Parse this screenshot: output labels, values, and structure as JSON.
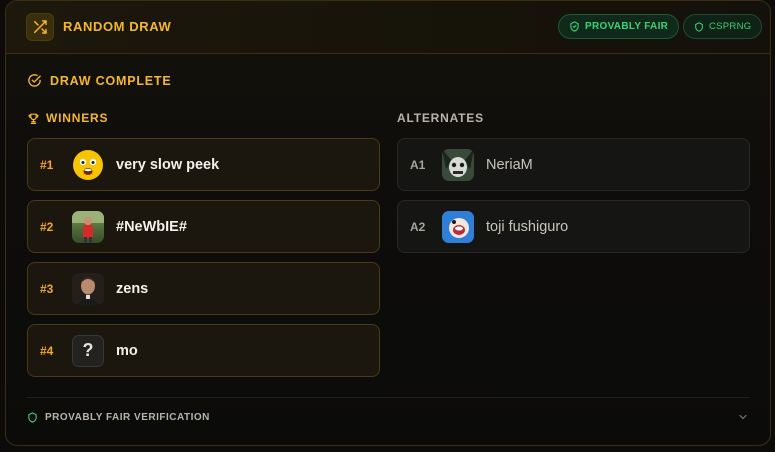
{
  "header": {
    "title": "RANDOM DRAW",
    "badge_fair": "PROVABLY FAIR",
    "badge_csprng": "CSPRNG"
  },
  "status": {
    "label": "DRAW COMPLETE"
  },
  "winners": {
    "heading": "WINNERS",
    "items": [
      {
        "rank": "#1",
        "name": "very slow peek",
        "avatar": "yellow-face-avatar"
      },
      {
        "rank": "#2",
        "name": "#NeWbIE#",
        "avatar": "red-figure-avatar"
      },
      {
        "rank": "#3",
        "name": "zens",
        "avatar": "portrait-avatar"
      },
      {
        "rank": "#4",
        "name": "mo",
        "avatar": "unknown-avatar"
      }
    ]
  },
  "alternates": {
    "heading": "ALTERNATES",
    "items": [
      {
        "rank": "A1",
        "name": "NeriaM",
        "avatar": "dark-creature-avatar"
      },
      {
        "rank": "A2",
        "name": "toji fushiguro",
        "avatar": "blue-cartoon-avatar"
      }
    ]
  },
  "footer": {
    "label": "PROVABLY FAIR VERIFICATION"
  },
  "colors": {
    "accent": "#f5b82a",
    "success": "#3bd17a"
  },
  "unknown_avatar_glyph": "?"
}
